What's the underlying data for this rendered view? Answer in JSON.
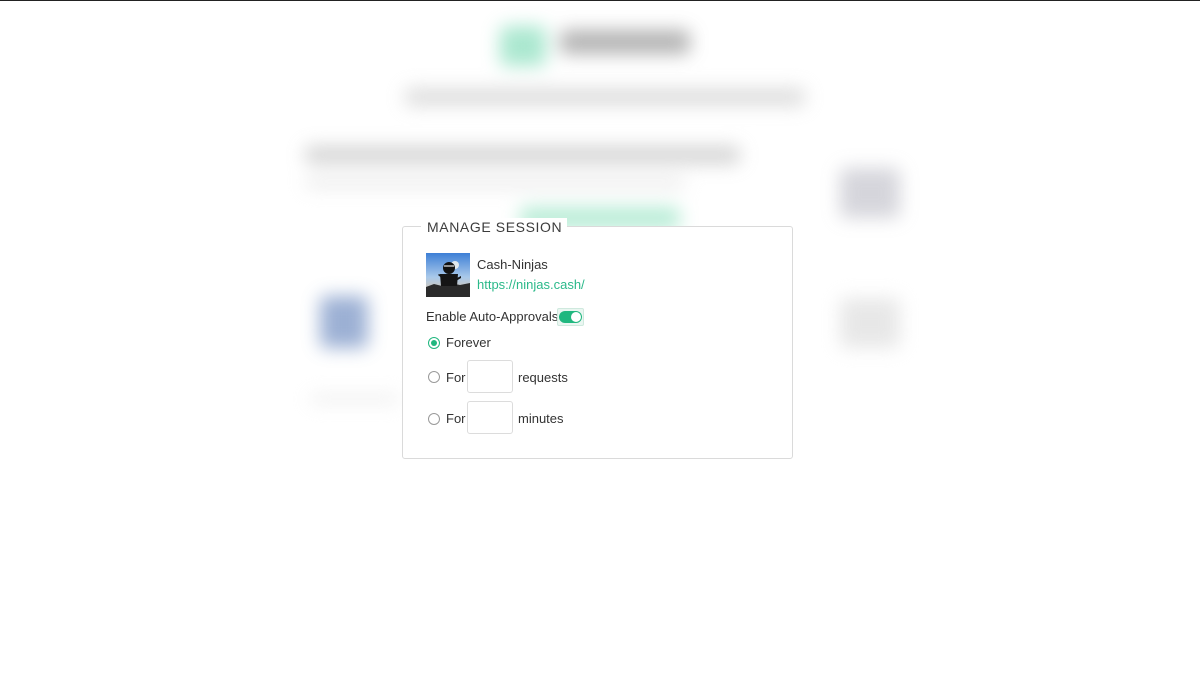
{
  "dialog": {
    "title": "MANAGE SESSION",
    "app": {
      "name": "Cash-Ninjas",
      "url": "https://ninjas.cash/"
    },
    "auto_approvals": {
      "label": "Enable Auto-Approvals",
      "enabled": true
    },
    "options": [
      {
        "prefix": "Forever",
        "selected": true
      },
      {
        "prefix": "For",
        "value": "",
        "suffix": "requests",
        "selected": false
      },
      {
        "prefix": "For",
        "value": "",
        "suffix": "minutes",
        "selected": false
      }
    ]
  },
  "colors": {
    "accent": "#20b77f",
    "link": "#2bb98a",
    "border": "#dadada",
    "text": "#333333"
  },
  "icons": {
    "app_icon": "ninja-avatar-icon",
    "toggle": "toggle-switch-icon"
  }
}
